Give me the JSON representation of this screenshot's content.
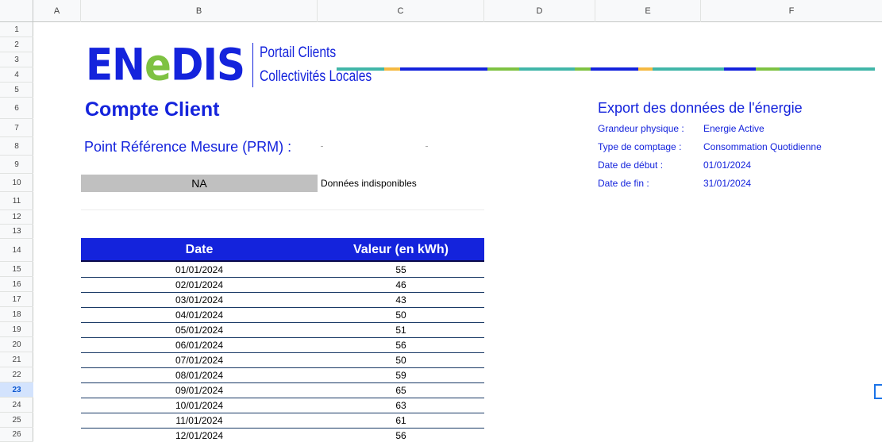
{
  "sheet": {
    "columns": [
      "A",
      "B",
      "C",
      "D",
      "E",
      "F"
    ],
    "rows": [
      "1",
      "2",
      "3",
      "4",
      "5",
      "6",
      "7",
      "8",
      "9",
      "10",
      "11",
      "12",
      "13",
      "14",
      "15",
      "16",
      "17",
      "18",
      "19",
      "20",
      "21",
      "22",
      "23",
      "24",
      "25",
      "26"
    ],
    "active_row": "23"
  },
  "logo": {
    "mark_part1": "EN",
    "mark_part2": "e",
    "mark_part3": "DIS",
    "line1": "Portail Clients",
    "line2": "Collectivités Locales",
    "brand_blue": "#1423dc",
    "brand_green": "#7ec242"
  },
  "header": {
    "title": "Compte Client",
    "prm_label": "Point Référence Mesure (PRM) :"
  },
  "status": {
    "code": "NA",
    "description": "Données indisponibles"
  },
  "export": {
    "title": "Export des données de l'énergie",
    "fields": [
      {
        "label": "Grandeur physique :",
        "value": "Energie Active"
      },
      {
        "label": "Type de comptage :",
        "value": "Consommation Quotidienne"
      },
      {
        "label": "Date de début :",
        "value": "01/01/2024"
      },
      {
        "label": "Date de fin :",
        "value": "31/01/2024"
      }
    ]
  },
  "table": {
    "headers": {
      "date": "Date",
      "value": "Valeur (en kWh)"
    },
    "header_color": "#1423dc",
    "rows": [
      {
        "date": "01/01/2024",
        "value": "55"
      },
      {
        "date": "02/01/2024",
        "value": "46"
      },
      {
        "date": "03/01/2024",
        "value": "43"
      },
      {
        "date": "04/01/2024",
        "value": "50"
      },
      {
        "date": "05/01/2024",
        "value": "51"
      },
      {
        "date": "06/01/2024",
        "value": "56"
      },
      {
        "date": "07/01/2024",
        "value": "50"
      },
      {
        "date": "08/01/2024",
        "value": "59"
      },
      {
        "date": "09/01/2024",
        "value": "65"
      },
      {
        "date": "10/01/2024",
        "value": "63"
      },
      {
        "date": "11/01/2024",
        "value": "61"
      },
      {
        "date": "12/01/2024",
        "value": "56"
      }
    ]
  }
}
